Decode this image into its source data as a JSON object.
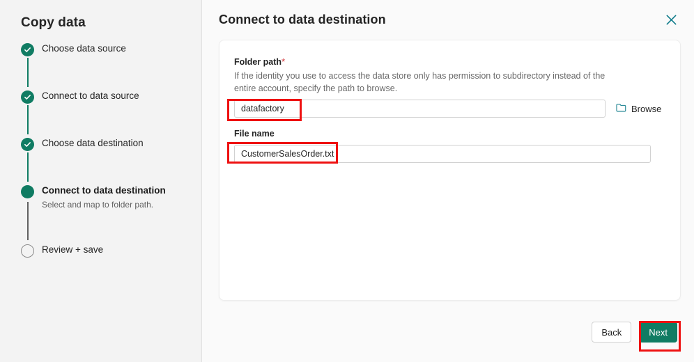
{
  "sidebar": {
    "title": "Copy data",
    "steps": [
      {
        "label": "Choose data source",
        "state": "done",
        "sub": ""
      },
      {
        "label": "Connect to data source",
        "state": "done",
        "sub": ""
      },
      {
        "label": "Choose data destination",
        "state": "done",
        "sub": ""
      },
      {
        "label": "Connect to data destination",
        "state": "current",
        "sub": "Select and map to folder path."
      },
      {
        "label": "Review + save",
        "state": "todo",
        "sub": ""
      }
    ]
  },
  "header": {
    "title": "Connect to data destination",
    "close_icon": "close-icon"
  },
  "form": {
    "folder_path": {
      "label": "Folder path",
      "required_marker": "*",
      "description": "If the identity you use to access the data store only has permission to subdirectory instead of the entire account, specify the path to browse.",
      "value": "datafactory",
      "placeholder": ""
    },
    "browse": {
      "label": "Browse",
      "icon": "folder-icon"
    },
    "file_name": {
      "label": "File name",
      "value": "CustomerSalesOrder.txt",
      "placeholder": ""
    }
  },
  "footer": {
    "back_label": "Back",
    "next_label": "Next"
  },
  "colors": {
    "accent_green": "#107c63",
    "teal_icon": "#0f7b8a",
    "required_red": "#d13438",
    "annotation_red": "#ee1111",
    "sidebar_bg": "#f3f3f3",
    "main_bg": "#fafafa",
    "card_bg": "#ffffff"
  }
}
